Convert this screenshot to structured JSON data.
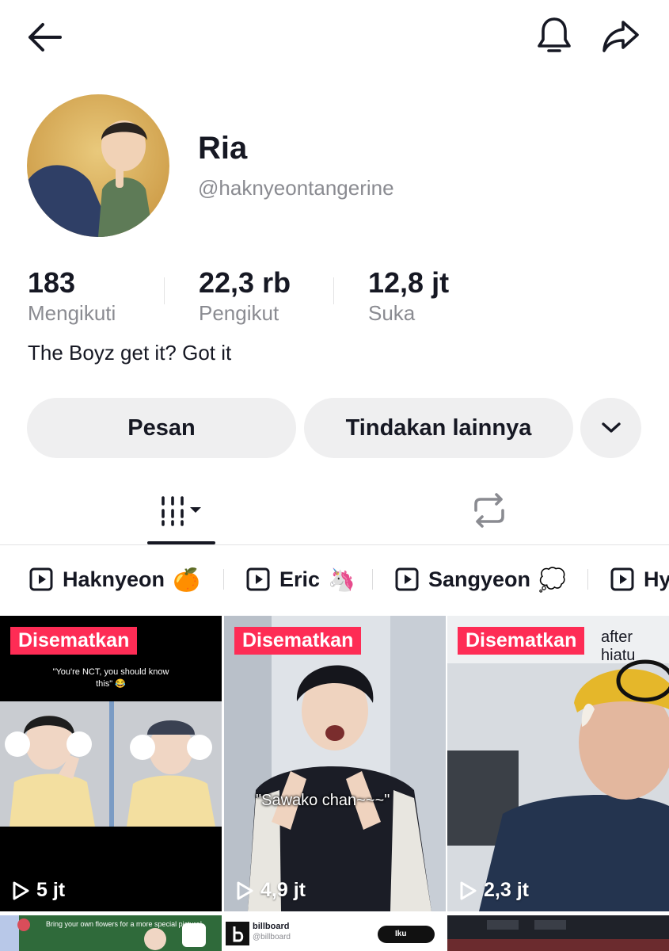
{
  "profile": {
    "display_name": "Ria",
    "username": "@haknyeontangerine",
    "bio": "The Boyz get it? Got it"
  },
  "stats": [
    {
      "value": "183",
      "label": "Mengikuti"
    },
    {
      "value": "22,3 rb",
      "label": "Pengikut"
    },
    {
      "value": "12,8 jt",
      "label": "Suka"
    }
  ],
  "actions": {
    "message_label": "Pesan",
    "more_label": "Tindakan lainnya",
    "dropdown_icon": "chevron-down-icon"
  },
  "header": {
    "back_icon": "back-arrow-icon",
    "bell_icon": "bell-icon",
    "share_icon": "share-icon"
  },
  "tabs": [
    {
      "name": "videos",
      "icon": "grid-icon",
      "active": true
    },
    {
      "name": "reposts",
      "icon": "repost-icon",
      "active": false
    }
  ],
  "playlists": [
    {
      "label": "Haknyeon",
      "emoji": "🍊"
    },
    {
      "label": "Eric",
      "emoji": "🦄"
    },
    {
      "label": "Sangyeon",
      "emoji": "💭"
    },
    {
      "label": "Hy",
      "emoji": ""
    }
  ],
  "videos": [
    {
      "badge": "Disematkan",
      "views": "5 jt",
      "caption": "\"You're NCT, you should know this\" 😂"
    },
    {
      "badge": "Disematkan",
      "views": "4,9 jt",
      "caption": "\"Sawako chan~~~\""
    },
    {
      "badge": "Disematkan",
      "views": "2,3 jt",
      "caption": "after hiatu"
    }
  ],
  "row2": {
    "tile1_caption": "Bring your own flowers for a more special picture!",
    "tile2_name": "billboard",
    "tile2_handle": "@billboard",
    "tile2_button": "Iku"
  },
  "colors": {
    "accent": "#fe2c55",
    "text": "#161823",
    "muted": "#8a8b91",
    "button_bg": "#efeff0"
  }
}
